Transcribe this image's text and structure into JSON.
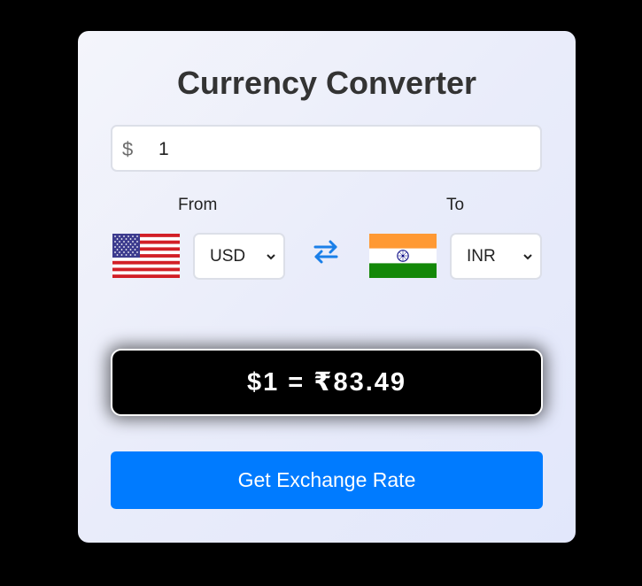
{
  "converter": {
    "title": "Currency Converter",
    "amount_symbol": "$",
    "amount_value": "1",
    "from_label": "From",
    "to_label": "To",
    "from_currency": "USD",
    "to_currency": "INR",
    "from_flag": "us-flag",
    "to_flag": "india-flag",
    "swap_icon": "swap-arrows-icon",
    "result_text": "$1 = ₹83.49",
    "button_label": "Get Exchange Rate"
  },
  "colors": {
    "accent": "#007bff",
    "result_background": "#000000",
    "page_background": "#000000"
  }
}
